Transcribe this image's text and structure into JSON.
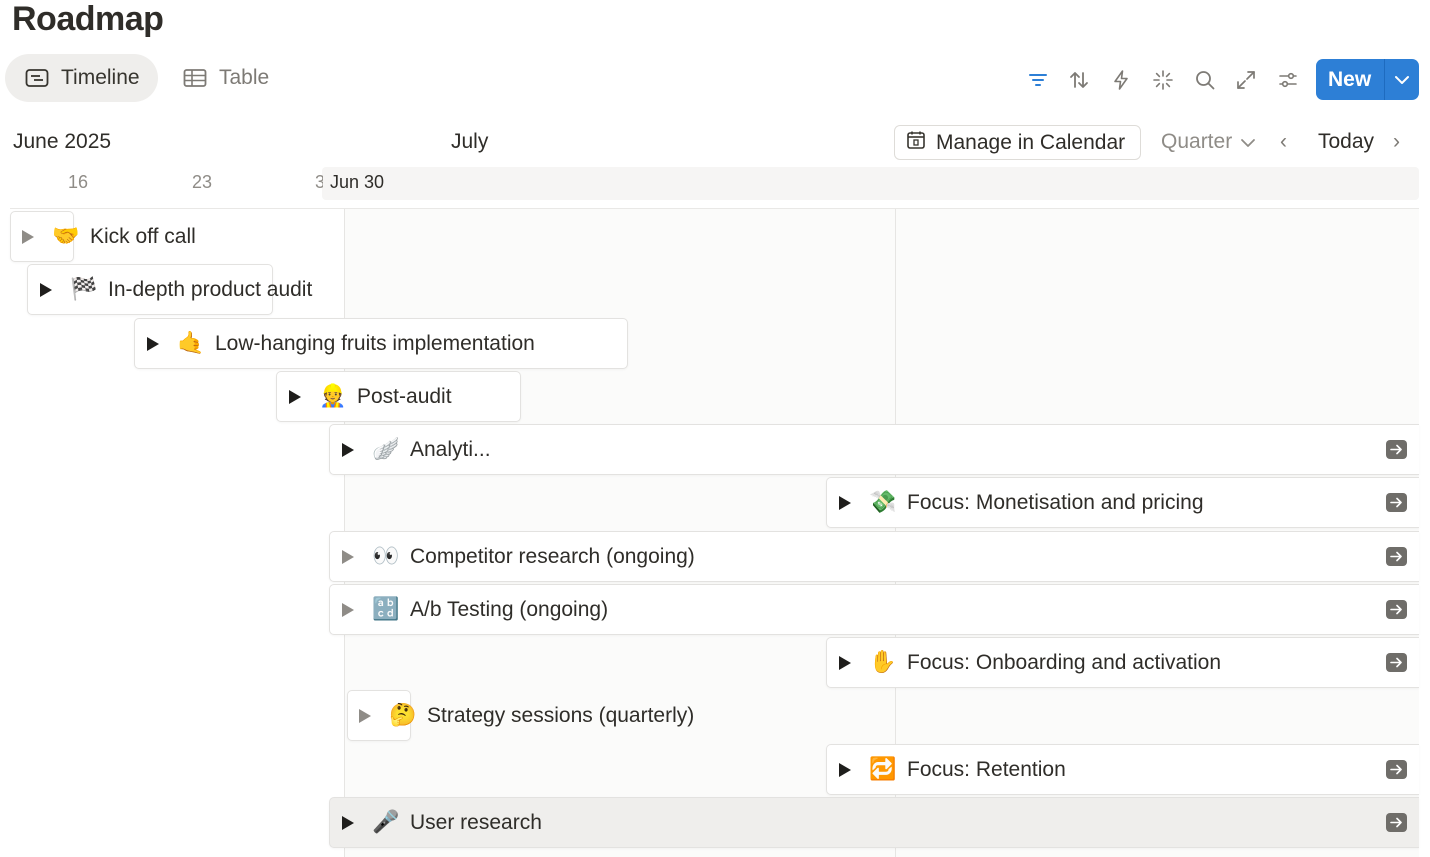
{
  "page": {
    "title": "Roadmap"
  },
  "views": [
    {
      "label": "Timeline",
      "active": true
    },
    {
      "label": "Table",
      "active": false
    }
  ],
  "toolbar": {
    "icons": [
      "filter-icon",
      "sort-icon",
      "automation-icon",
      "ai-sparkle-icon",
      "search-icon",
      "expand-icon",
      "settings-icon"
    ],
    "new_label": "New"
  },
  "timeline": {
    "months": [
      "June 2025",
      "July"
    ],
    "days": [
      "16",
      "23",
      "3",
      "Jun 30"
    ],
    "calendar_button": "Manage in Calendar",
    "zoom": "Quarter",
    "prev": "‹",
    "today": "Today",
    "next": "›"
  },
  "tasks": [
    {
      "emoji": "🤝",
      "label": "Kick off call"
    },
    {
      "emoji": "🏁",
      "label": "In-depth product audit"
    },
    {
      "emoji": "🤙",
      "label": "Low-hanging fruits implementation"
    },
    {
      "emoji": "👷",
      "label": "Post-audit"
    },
    {
      "emoji": "🪽",
      "label": "Analyti..."
    },
    {
      "emoji": "💸",
      "label": "Focus: Monetisation and pricing"
    },
    {
      "emoji": "👀",
      "label": "Competitor research (ongoing)"
    },
    {
      "emoji": "🔡",
      "label": "A/b Testing (ongoing)"
    },
    {
      "emoji": "✋",
      "label": "Focus: Onboarding and activation"
    },
    {
      "emoji": "🤔",
      "label": "Strategy sessions (quarterly)"
    },
    {
      "emoji": "🔁",
      "label": "Focus: Retention"
    },
    {
      "emoji": "🎤",
      "label": "User research"
    }
  ],
  "colors": {
    "accent": "#2d7fd6",
    "filter_active": "#2d7fd6"
  }
}
